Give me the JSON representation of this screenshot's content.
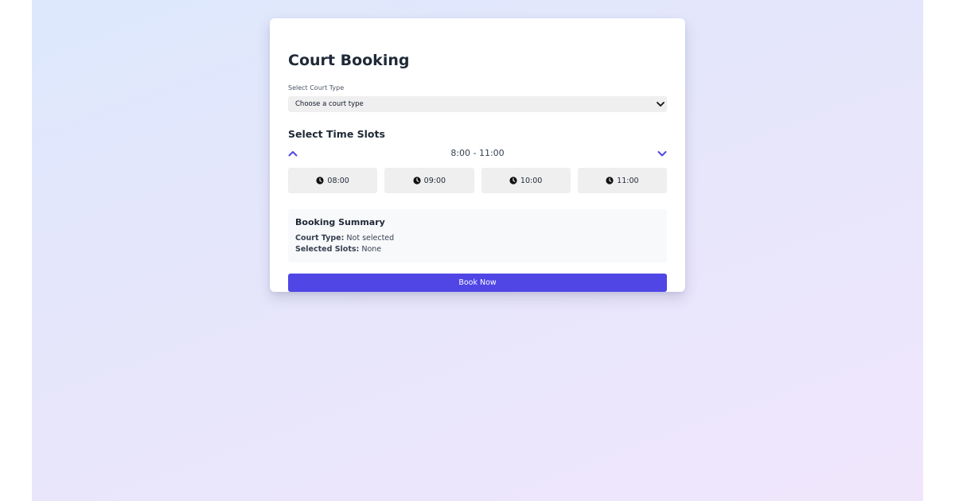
{
  "page": {
    "title": "Court Booking"
  },
  "court_type": {
    "label": "Select Court Type",
    "selected": "Choose a court type"
  },
  "time_slots": {
    "title": "Select Time Slots",
    "range": "8:00 - 11:00",
    "slots": [
      "08:00",
      "09:00",
      "10:00",
      "11:00"
    ]
  },
  "summary": {
    "title": "Booking Summary",
    "court_type_label": "Court Type:",
    "court_type_value": "Not selected",
    "slots_label": "Selected Slots:",
    "slots_value": "None"
  },
  "actions": {
    "book_label": "Book Now"
  },
  "colors": {
    "accent": "#4f46e5",
    "slot_bg": "#efefef"
  }
}
